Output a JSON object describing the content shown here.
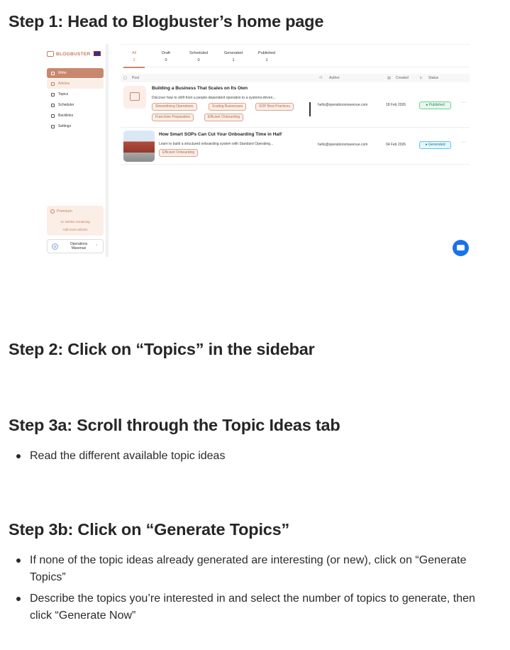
{
  "steps": {
    "step1": "Step 1: Head to Blogbuster’s home page",
    "step2": "Step 2: Click on “Topics” in the sidebar",
    "step3a": "Step 3a: Scroll through the Topic Ideas tab",
    "step3a_bullets": [
      "Read the different available topic ideas"
    ],
    "step3b": "Step 3b: Click on “Generate Topics”",
    "step3b_bullets": [
      "If none of the topic ideas already generated are interesting (or new), click on “Generate Topics”",
      "Describe the topics you’re interested in and select the number of topics to generate, then click “Generate Now”"
    ]
  },
  "screenshot": {
    "brand": "BLOGBUSTER",
    "nav": [
      "Write",
      "Articles",
      "Topics",
      "Scheduler",
      "Backlinks",
      "Settings"
    ],
    "premium": {
      "title": "Premium",
      "remaining": "11 articles remaining",
      "add": "Add more articles"
    },
    "account": {
      "initial": "O",
      "name": "Operations Mavenue"
    },
    "tabs": [
      {
        "label": "All",
        "count": "2"
      },
      {
        "label": "Draft",
        "count": "0"
      },
      {
        "label": "Scheduled",
        "count": "0"
      },
      {
        "label": "Generated",
        "count": "1"
      },
      {
        "label": "Published",
        "count": "1"
      }
    ],
    "columns": {
      "post": "Post",
      "author": "Author",
      "created": "Created",
      "status": "Status"
    },
    "rows": [
      {
        "title": "Building a Business That Scales on Its Own",
        "desc": "Discover how to shift from a people-dependent operation to a systems-driven...",
        "tags": [
          "Streamlining Operations",
          "Scaling Businesses",
          "SOP Best Practices",
          "Franchise Preparation",
          "Efficient Onboarding"
        ],
        "author": "hello@operationsmavenue.com",
        "created": "18 Feb 2026",
        "status": "Published",
        "more": "···"
      },
      {
        "title": "How Smart SOPs Can Cut Your Onboarding Time in Half",
        "desc": "Learn to build a structured onboarding system with Standard Operating...",
        "tags": [
          "Efficient Onboarding"
        ],
        "author": "hello@operationsmavenue.com",
        "created": "04 Feb 2026",
        "status": "Generated",
        "more": "···"
      }
    ]
  }
}
